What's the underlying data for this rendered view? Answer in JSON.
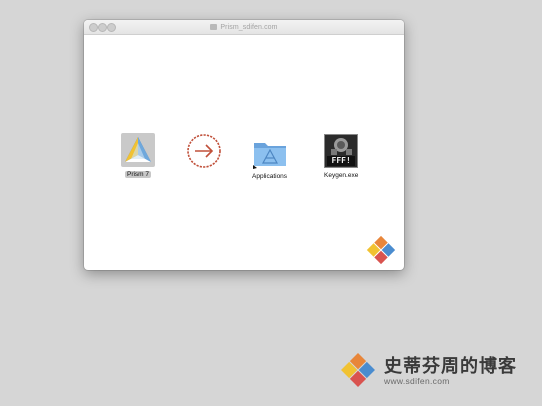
{
  "window": {
    "title": "Prism_sdifen.com"
  },
  "dmg": {
    "items": [
      {
        "label": "Prism 7",
        "icon": "prism-app-icon",
        "selected": true
      },
      {
        "label": "",
        "icon": "arrow-right-circle-icon"
      },
      {
        "label": "Applications",
        "icon": "applications-folder-icon"
      },
      {
        "label": "Keygen.exe",
        "icon": "keygen-icon",
        "badge": "FFF!"
      }
    ]
  },
  "watermark": {
    "title": "史蒂芬周的博客",
    "url": "www.sdifen.com"
  },
  "colors": {
    "desktop": "#d6d6d6",
    "arrow": "#c0503a",
    "folder": "#7fb4e6",
    "logo_orange": "#e8863a",
    "logo_blue": "#4a8ccf",
    "logo_yellow": "#f1c232",
    "logo_red": "#d9534f"
  }
}
